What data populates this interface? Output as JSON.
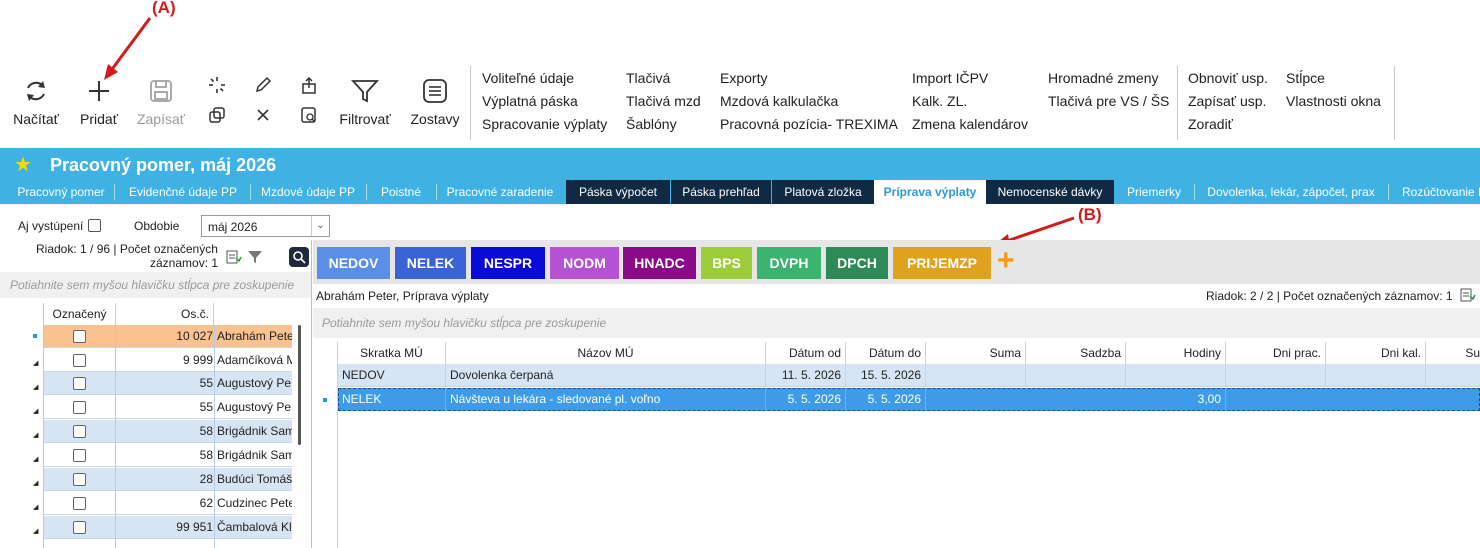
{
  "annotations": {
    "a": "(A)",
    "b": "(B)"
  },
  "ribbon": {
    "reload_label": "Načítať",
    "add_label": "Pridať",
    "save_label": "Zapísať",
    "filter_label": "Filtrovať",
    "reports_label": "Zostavy",
    "menu_col1": [
      "Voliteľné údaje",
      "Výplatná páska",
      "Spracovanie výplaty"
    ],
    "menu_col2": [
      "Tlačivá",
      "Tlačivá mzd",
      "Šablóny"
    ],
    "menu_col3": [
      "Exporty",
      "Mzdová kalkulačka",
      "Pracovná pozícia- TREXIMA"
    ],
    "menu_col4": [
      "Import IČPV",
      "Kalk. ZL.",
      "Zmena kalendárov"
    ],
    "menu_col5": [
      "Hromadné zmeny",
      "Tlačivá pre VS / ŠS"
    ],
    "menu_col6": [
      "Obnoviť usp.",
      "Zapísať usp.",
      "Zoradiť"
    ],
    "menu_col7": [
      "Stĺpce",
      "Vlastnosti okna"
    ]
  },
  "header": {
    "title": "Pracovný pomer, máj 2026",
    "tabs": [
      {
        "label": "Pracovný pomer"
      },
      {
        "label": "Evidenčné údaje PP"
      },
      {
        "label": "Mzdové údaje PP"
      },
      {
        "label": "Poistné"
      },
      {
        "label": "Pracovné zaradenie"
      },
      {
        "label": "Páska výpočet"
      },
      {
        "label": "Páska prehľad"
      },
      {
        "label": "Platová zložka"
      },
      {
        "label": "Príprava výplaty"
      },
      {
        "label": "Nemocenské dávky"
      },
      {
        "label": "Priemerky"
      },
      {
        "label": "Dovolenka, lekár, zápočet, prax"
      },
      {
        "label": "Rozúčtovanie P"
      }
    ]
  },
  "filter": {
    "include_left_label": "Aj vystúpení",
    "period_label": "Obdobie",
    "period_value": "máj 2026"
  },
  "left_panel": {
    "status": "Riadok: 1 / 96 | Počet označených",
    "status2": "záznamov: 1",
    "group_hint": "Potiahnite sem myšou hlavičku stĺpca pre zoskupenie",
    "col_marked": "Označený",
    "col_num": "Os.č.",
    "rows": [
      {
        "num": "10 027",
        "name": "Abrahám Peter"
      },
      {
        "num": "9 999",
        "name": "Adamčíková M"
      },
      {
        "num": "55",
        "name": "Augustový Pe"
      },
      {
        "num": "55",
        "name": "Augustový Pe"
      },
      {
        "num": "58",
        "name": "Brigádnik Sam"
      },
      {
        "num": "58",
        "name": "Brigádnik Sam"
      },
      {
        "num": "28",
        "name": "Budúci Tomáš"
      },
      {
        "num": "62",
        "name": "Cudzinec Pete"
      },
      {
        "num": "99 951",
        "name": "Čambalová Kla"
      }
    ]
  },
  "chips": [
    {
      "label": "NEDOV",
      "color": "#5b8fe6"
    },
    {
      "label": "NELEK",
      "color": "#3b63d6"
    },
    {
      "label": "NESPR",
      "color": "#0a0ad8"
    },
    {
      "label": "NODM",
      "color": "#b551d3"
    },
    {
      "label": "HNADC",
      "color": "#8a0a8a"
    },
    {
      "label": "BPS",
      "color": "#9ccb3b"
    },
    {
      "label": "DVPH",
      "color": "#3cb371"
    },
    {
      "label": "DPCH",
      "color": "#2e8b57"
    },
    {
      "label": "PRIJEMZP",
      "color": "#e0a21c"
    }
  ],
  "add_chip_glyph": "+",
  "right_panel": {
    "subtitle": "Abrahám Peter, Príprava výplaty",
    "status": "Riadok: 2 / 2 | Počet označených záznamov: 1",
    "group_hint": "Potiahnite sem myšou hlavičku stĺpca pre zoskupenie",
    "columns": [
      "Skratka MÚ",
      "Názov MÚ",
      "Dátum od",
      "Dátum do",
      "Suma",
      "Sadzba",
      "Hodiny",
      "Dni prac.",
      "Dni kal.",
      "Su"
    ],
    "rows": [
      {
        "code": "NEDOV",
        "name": "Dovolenka čerpaná",
        "from": "11. 5. 2026",
        "to": "15. 5. 2026",
        "hours": ""
      },
      {
        "code": "NELEK",
        "name": "Návšteva u lekára - sledované pl. voľno",
        "from": "5. 5. 2026",
        "to": "5. 5. 2026",
        "hours": "3,00"
      }
    ]
  }
}
